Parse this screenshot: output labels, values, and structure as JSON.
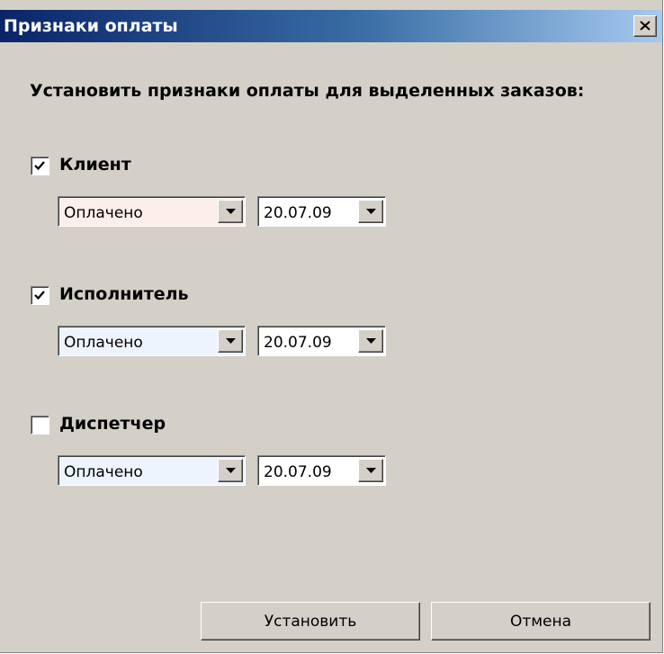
{
  "window": {
    "title": "Признаки оплаты"
  },
  "instruction": "Установить признаки оплаты для выделенных заказов:",
  "sections": [
    {
      "label": "Клиент",
      "checked": true,
      "status": "Оплачено",
      "date": "20.07.09",
      "status_bg": "#fceee9"
    },
    {
      "label": "Исполнитель",
      "checked": true,
      "status": "Оплачено",
      "date": "20.07.09",
      "status_bg": "#eef4fd"
    },
    {
      "label": "Диспетчер",
      "checked": false,
      "status": "Оплачено",
      "date": "20.07.09",
      "status_bg": "#eef4fd"
    }
  ],
  "buttons": {
    "apply": "Установить",
    "cancel": "Отмена"
  }
}
